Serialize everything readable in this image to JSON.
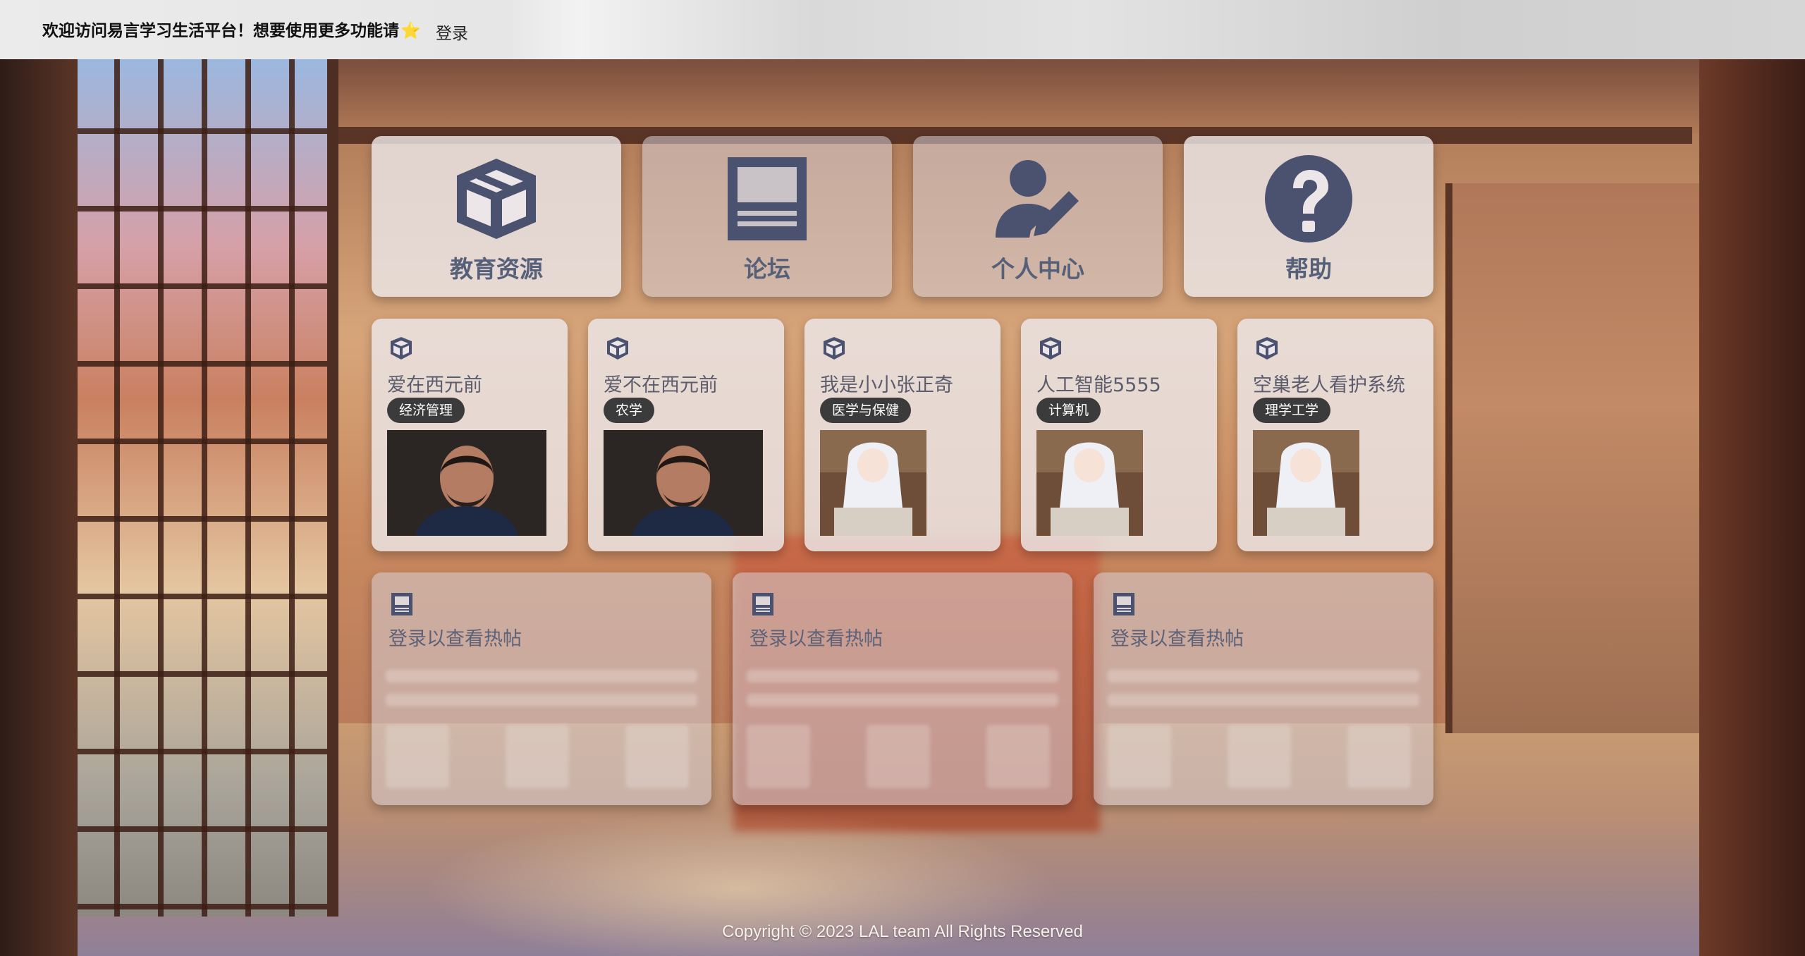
{
  "header": {
    "welcome": "欢迎访问易言学习生活平台！想要使用更多功能请",
    "star": "⭐",
    "login": "登录"
  },
  "nav": [
    {
      "label": "教育资源",
      "icon": "box-icon"
    },
    {
      "label": "论坛",
      "icon": "forum-icon"
    },
    {
      "label": "个人中心",
      "icon": "user-edit-icon"
    },
    {
      "label": "帮助",
      "icon": "question-icon"
    }
  ],
  "resources": [
    {
      "title": "爱在西元前",
      "tag": "经济管理",
      "image": "man-portrait"
    },
    {
      "title": "爱不在西元前",
      "tag": "农学",
      "image": "man-portrait"
    },
    {
      "title": "我是小小张正奇",
      "tag": "医学与保健",
      "image": "anime-girl-reading"
    },
    {
      "title": "人工智能5555",
      "tag": "计算机",
      "image": "anime-girl-reading"
    },
    {
      "title": "空巢老人看护系统",
      "tag": "理学工学",
      "image": "anime-girl-reading"
    }
  ],
  "hot_posts": [
    {
      "text": "登录以查看热帖",
      "icon": "forum-icon"
    },
    {
      "text": "登录以查看热帖",
      "icon": "forum-icon"
    },
    {
      "text": "登录以查看热帖",
      "icon": "forum-icon"
    }
  ],
  "footer": "Copyright © 2023 LAL team All Rights Reserved",
  "colors": {
    "icon": "#4a5270",
    "nav_label": "#566078",
    "tag_bg": "#3b3b3b"
  }
}
